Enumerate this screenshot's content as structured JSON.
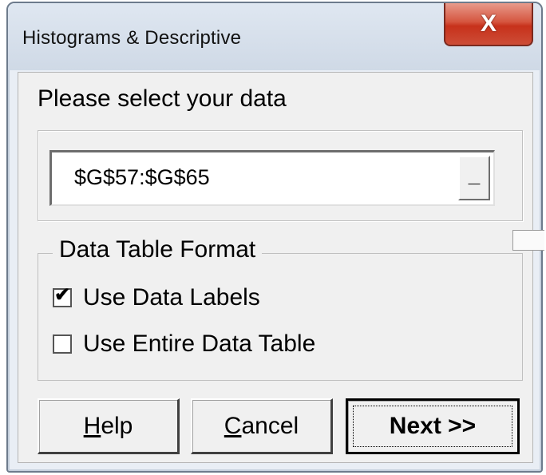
{
  "window": {
    "title": "Histograms & Descriptive",
    "close_glyph": "X"
  },
  "prompt": "Please select your data",
  "range": {
    "value": "$G$57:$G$65",
    "button_label": "_"
  },
  "format": {
    "legend": "Data Table Format",
    "use_labels": {
      "label": "Use Data Labels",
      "checked": true
    },
    "use_entire": {
      "label": "Use Entire Data Table",
      "checked": false
    }
  },
  "buttons": {
    "help": {
      "accel": "H",
      "rest": "elp"
    },
    "cancel": {
      "accel": "C",
      "rest": "ancel"
    },
    "next": "Next >>"
  },
  "icons": {
    "check": "✔"
  }
}
